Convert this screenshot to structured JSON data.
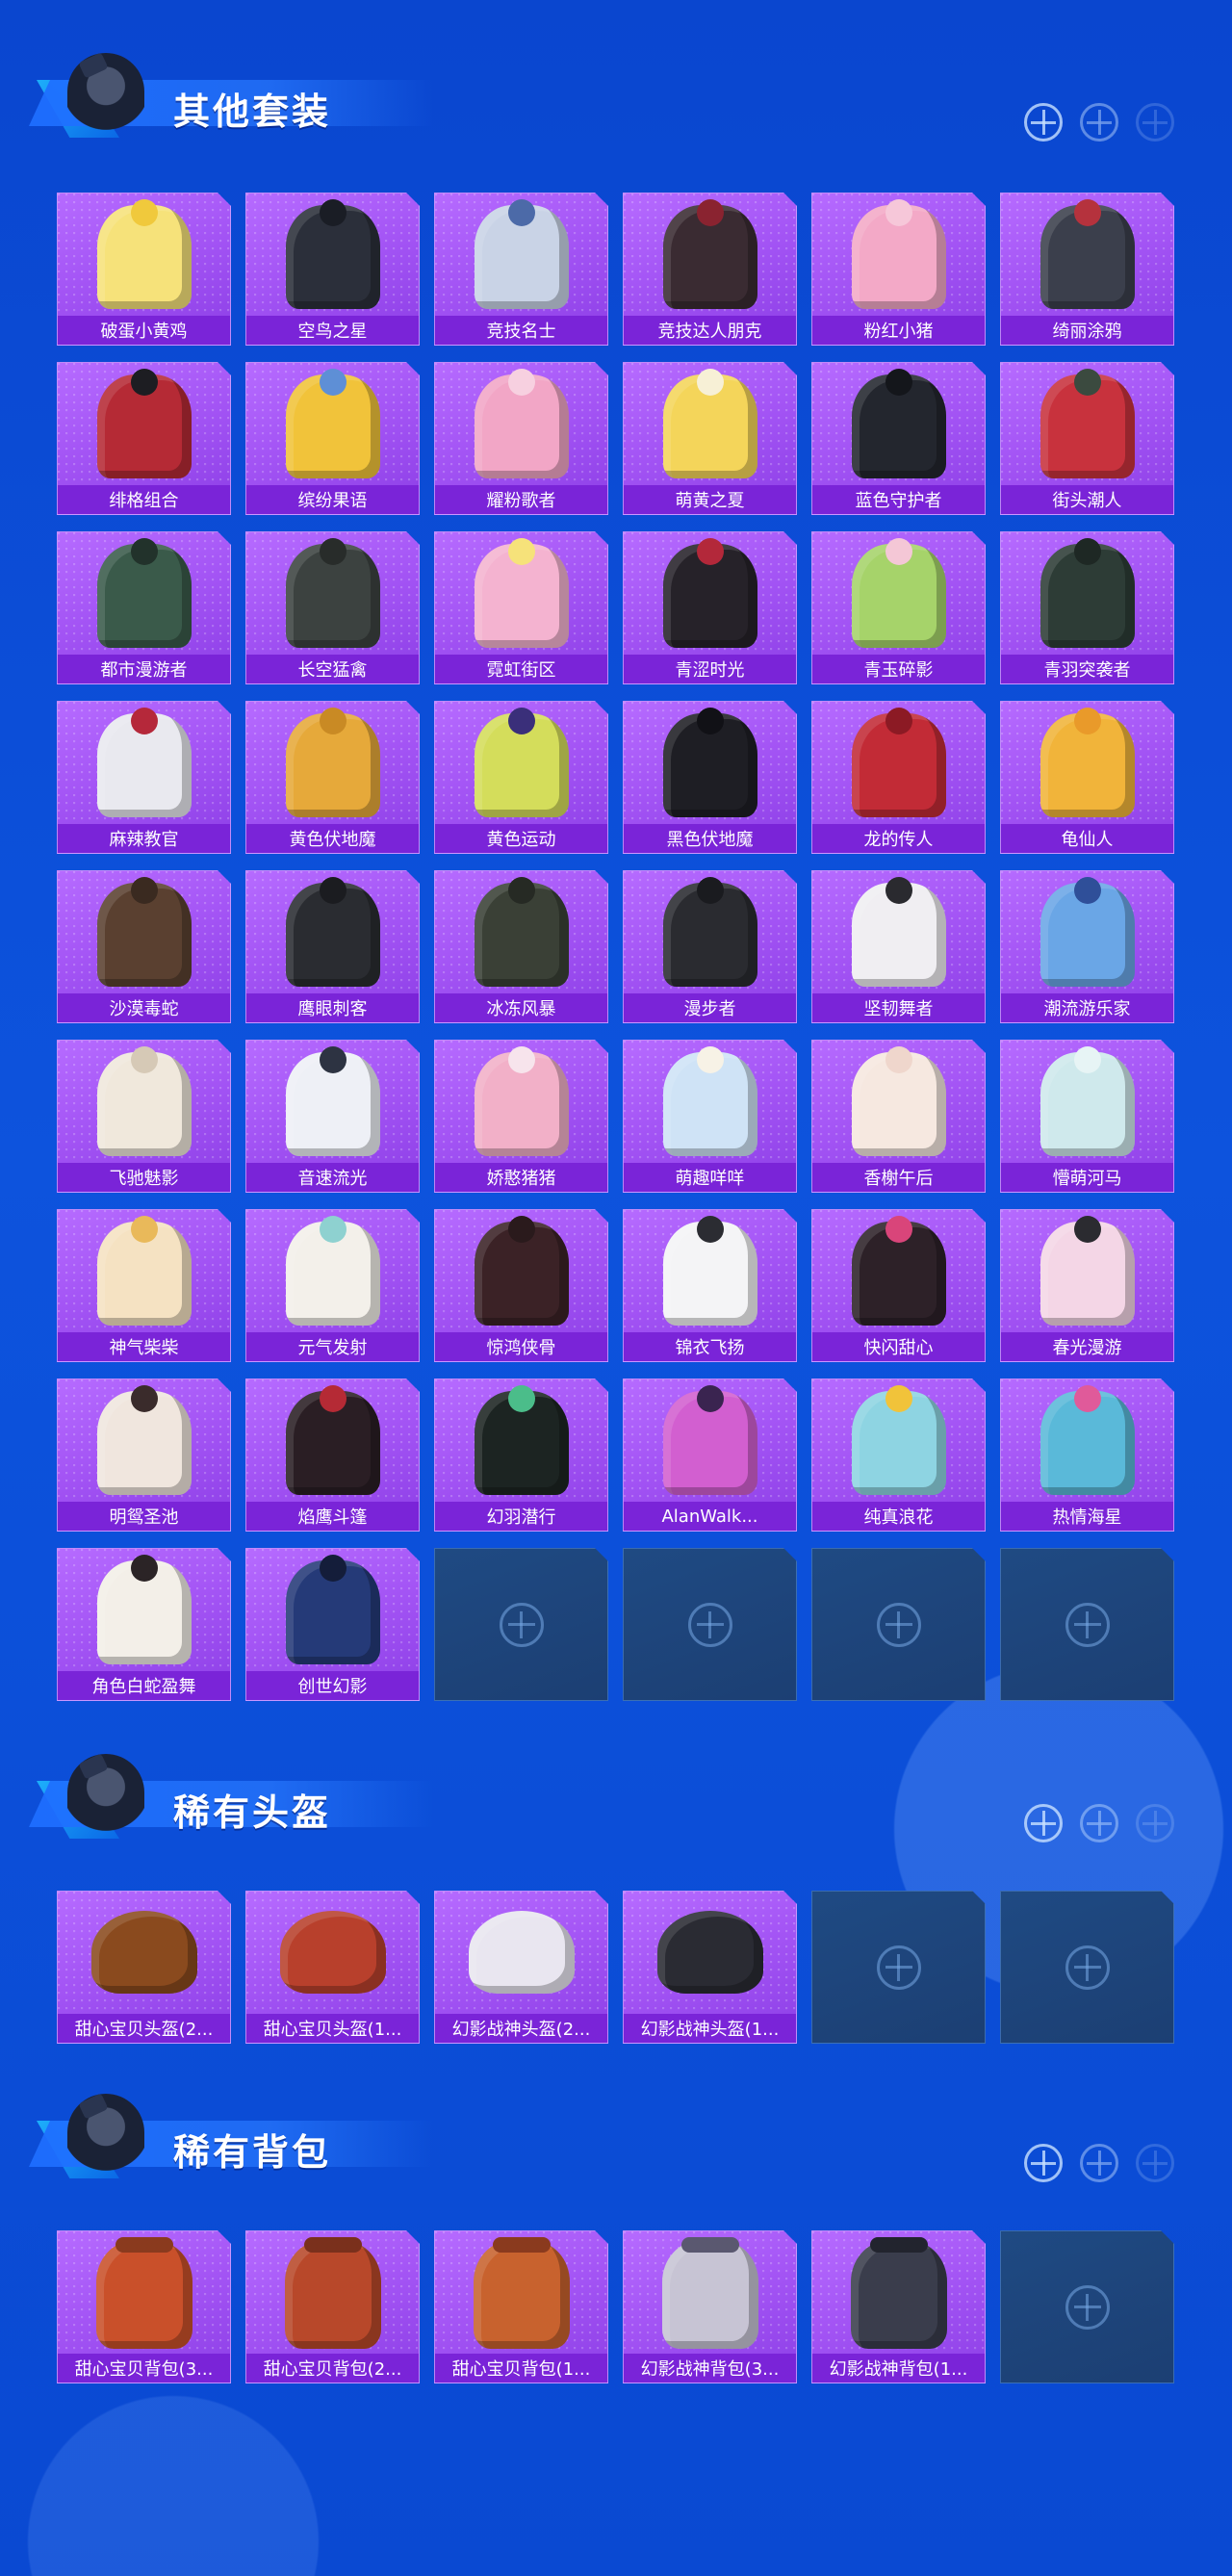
{
  "sections": [
    {
      "title": "其他套装",
      "items": [
        {
          "label": "破蛋小黄鸡",
          "color": "#f6e27a",
          "color2": "#f0c93c"
        },
        {
          "label": "空鸟之星",
          "color": "#2b2f3a",
          "color2": "#1a1d25"
        },
        {
          "label": "竞技名士",
          "color": "#c9d3e6",
          "color2": "#4c6aa8"
        },
        {
          "label": "竞技达人朋克",
          "color": "#3a2b32",
          "color2": "#8a2330"
        },
        {
          "label": "粉红小猪",
          "color": "#f3a9c7",
          "color2": "#f6c7d9"
        },
        {
          "label": "绮丽涂鸦",
          "color": "#3b3f4c",
          "color2": "#b5323d"
        },
        {
          "label": "绯格组合",
          "color": "#b52a35",
          "color2": "#1d1d22"
        },
        {
          "label": "缤纷果语",
          "color": "#f1c33a",
          "color2": "#5e8fd6"
        },
        {
          "label": "耀粉歌者",
          "color": "#f2a6c6",
          "color2": "#f7d0e0"
        },
        {
          "label": "萌黄之夏",
          "color": "#f4d55a",
          "color2": "#f7f0d6"
        },
        {
          "label": "蓝色守护者",
          "color": "#23262e",
          "color2": "#14161b"
        },
        {
          "label": "街头潮人",
          "color": "#c8323d",
          "color2": "#3b4a3f"
        },
        {
          "label": "都市漫游者",
          "color": "#3a5a4a",
          "color2": "#22322b"
        },
        {
          "label": "长空猛禽",
          "color": "#3c4240",
          "color2": "#282c2a"
        },
        {
          "label": "霓虹街区",
          "color": "#f4b3d0",
          "color2": "#f6e27a"
        },
        {
          "label": "青涩时光",
          "color": "#262229",
          "color2": "#b3283a"
        },
        {
          "label": "青玉碎影",
          "color": "#a6d36a",
          "color2": "#f4c7d6"
        },
        {
          "label": "青羽突袭者",
          "color": "#2d3c36",
          "color2": "#1e2824"
        },
        {
          "label": "麻辣教官",
          "color": "#e9e9ef",
          "color2": "#b5283a"
        },
        {
          "label": "黄色伏地魔",
          "color": "#e6a93a",
          "color2": "#c98a24"
        },
        {
          "label": "黄色运动",
          "color": "#d4dd5b",
          "color2": "#3a2f7a"
        },
        {
          "label": "黑色伏地魔",
          "color": "#1e1e24",
          "color2": "#111116"
        },
        {
          "label": "龙的传人",
          "color": "#c22b36",
          "color2": "#8c1a24"
        },
        {
          "label": "龟仙人",
          "color": "#f1b43a",
          "color2": "#e99a2a"
        },
        {
          "label": "沙漠毒蛇",
          "color": "#5a4030",
          "color2": "#3a2a20"
        },
        {
          "label": "鹰眼刺客",
          "color": "#2a2c31",
          "color2": "#1b1c20"
        },
        {
          "label": "冰冻风暴",
          "color": "#3a4036",
          "color2": "#262a24"
        },
        {
          "label": "漫步者",
          "color": "#2a2b30",
          "color2": "#1a1b1f"
        },
        {
          "label": "坚韧舞者",
          "color": "#f0eef2",
          "color2": "#2a2a2f"
        },
        {
          "label": "潮流游乐家",
          "color": "#6aa6e6",
          "color2": "#2f4f99"
        },
        {
          "label": "飞驰魅影",
          "color": "#f0e8dc",
          "color2": "#d6c9b6"
        },
        {
          "label": "音速流光",
          "color": "#eef0f6",
          "color2": "#2d3342"
        },
        {
          "label": "娇憨猪猪",
          "color": "#f2b0c8",
          "color2": "#f7e4ec"
        },
        {
          "label": "萌趣咩咩",
          "color": "#cfe3f6",
          "color2": "#f7f2e6"
        },
        {
          "label": "香榭午后",
          "color": "#f6e8e0",
          "color2": "#efd6cc"
        },
        {
          "label": "懵萌河马",
          "color": "#cfe9ec",
          "color2": "#e7f4f5"
        },
        {
          "label": "神气柴柴",
          "color": "#f5e2c2",
          "color2": "#e9b95a"
        },
        {
          "label": "元气发射",
          "color": "#f3f0ea",
          "color2": "#8ed1d0"
        },
        {
          "label": "惊鸿侠骨",
          "color": "#3b2226",
          "color2": "#2a1a1c"
        },
        {
          "label": "锦衣飞扬",
          "color": "#f4f4f6",
          "color2": "#2b2c32"
        },
        {
          "label": "快闪甜心",
          "color": "#2d2128",
          "color2": "#d9457a"
        },
        {
          "label": "春光漫游",
          "color": "#f4d6e6",
          "color2": "#2b2b30"
        },
        {
          "label": "明鸳圣池",
          "color": "#f0e6de",
          "color2": "#3a2b2b"
        },
        {
          "label": "焰鹰斗篷",
          "color": "#2a1e24",
          "color2": "#b52a35"
        },
        {
          "label": "幻羽潜行",
          "color": "#1c2422",
          "color2": "#4bbd8a"
        },
        {
          "label": "AlanWalk...",
          "color": "#d25fd0",
          "color2": "#3a2450"
        },
        {
          "label": "纯真浪花",
          "color": "#8ed4e2",
          "color2": "#f1c33a"
        },
        {
          "label": "热情海星",
          "color": "#5ab9d9",
          "color2": "#e05a9a"
        },
        {
          "label": "角色白蛇盈舞",
          "color": "#f3efe8",
          "color2": "#2b2426"
        },
        {
          "label": "创世幻影",
          "color": "#253a78",
          "color2": "#141d3a"
        }
      ],
      "empty_slots": 4
    },
    {
      "title": "稀有头盔",
      "items": [
        {
          "label": "甜心宝贝头盔(2...",
          "color": "#8a4a1e",
          "color2": "#6a3414"
        },
        {
          "label": "甜心宝贝头盔(1...",
          "color": "#b8402c",
          "color2": "#7a2a1c"
        },
        {
          "label": "幻影战神头盔(2...",
          "color": "#e9e6f0",
          "color2": "#2a2a33"
        },
        {
          "label": "幻影战神头盔(1...",
          "color": "#2a2b33",
          "color2": "#1a1b20"
        }
      ],
      "empty_slots": 2
    },
    {
      "title": "稀有背包",
      "items": [
        {
          "label": "甜心宝贝背包(3...",
          "color": "#c9502a",
          "color2": "#8a3a1e"
        },
        {
          "label": "甜心宝贝背包(2...",
          "color": "#b8482a",
          "color2": "#7a301c"
        },
        {
          "label": "甜心宝贝背包(1...",
          "color": "#c8622e",
          "color2": "#8a3a1e"
        },
        {
          "label": "幻影战神背包(3...",
          "color": "#c7c4d4",
          "color2": "#5a5870"
        },
        {
          "label": "幻影战神背包(1...",
          "color": "#3a3d4c",
          "color2": "#22242e"
        }
      ],
      "empty_slots": 1
    }
  ]
}
